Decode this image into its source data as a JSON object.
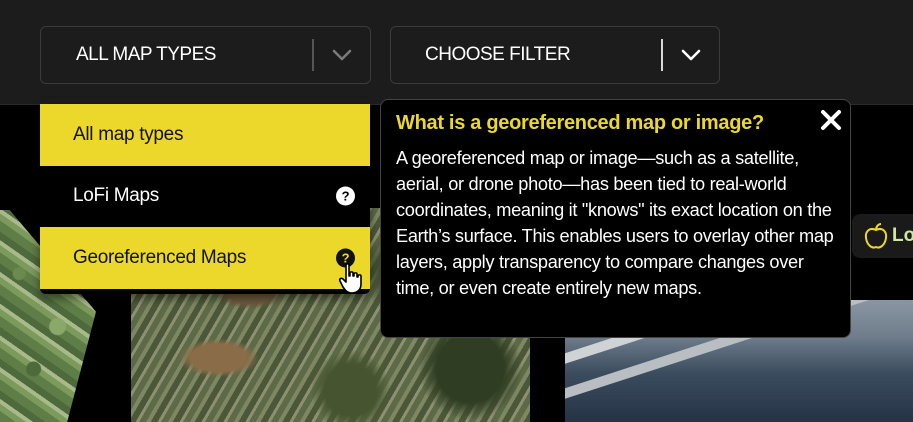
{
  "filters": {
    "map_types_label": "ALL MAP TYPES",
    "choose_filter_label": "CHOOSE FILTER"
  },
  "menu": {
    "items": [
      {
        "label": "All map types",
        "selected": true
      },
      {
        "label": "LoFi Maps",
        "help_icon": "question-circle-icon"
      },
      {
        "label": "Georeferenced Maps",
        "help_icon": "question-circle-icon",
        "hovered": true
      }
    ]
  },
  "tooltip": {
    "title": "What is a georeferenced map or image?",
    "body": "A georeferenced map or image—such as a satellite, aerial, or drone photo—has been tied to real-world coordinates, meaning it \"knows\" its exact location on the Earth’s surface. This enables users to overlay other map layers, apply transparency to compare changes over time, or even create entirely new maps."
  },
  "badge": {
    "icon": "apple-icon",
    "text": "Lo"
  },
  "colors": {
    "accent_yellow": "#ecd82a",
    "topbar_bg": "#1c1c1c",
    "menu_bg": "#000000"
  }
}
